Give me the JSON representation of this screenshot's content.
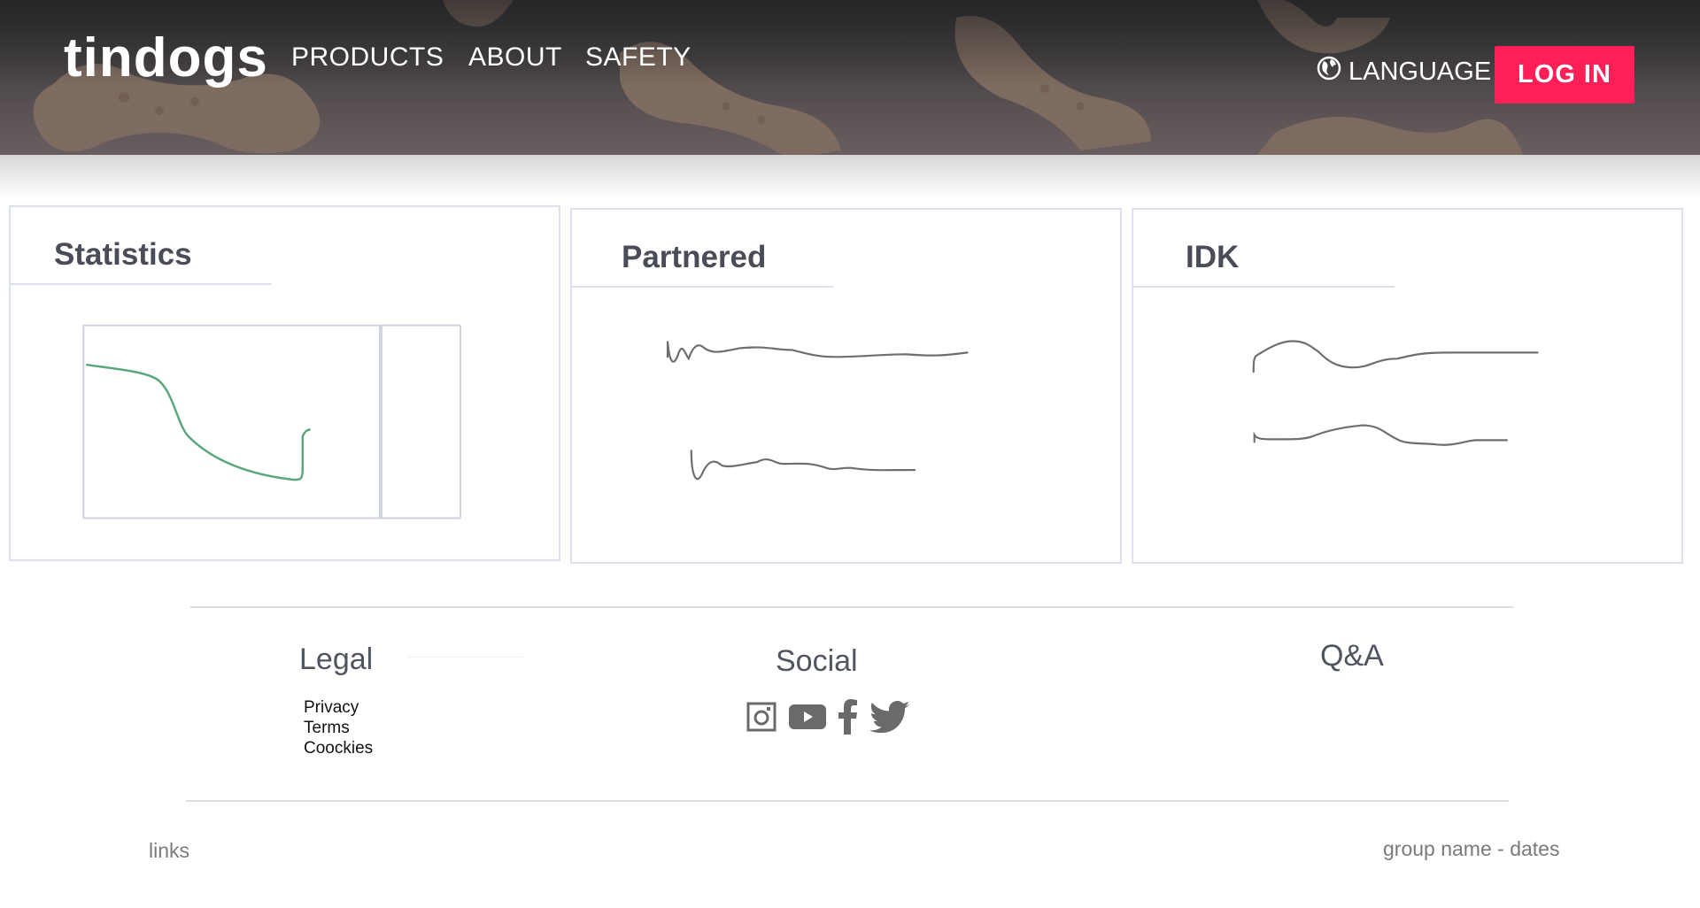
{
  "header": {
    "logo": "tindogs",
    "nav": [
      "PRODUCTS",
      "ABOUT",
      "SAFETY"
    ],
    "language_label": "LANGUAGE",
    "login_label": "LOG IN"
  },
  "cards": [
    {
      "title": "Statistics"
    },
    {
      "title": "Partnered"
    },
    {
      "title": "IDK"
    }
  ],
  "footer": {
    "legal": {
      "title": "Legal",
      "links": [
        "Privacy",
        "Terms",
        "Coockies"
      ]
    },
    "social": {
      "title": "Social",
      "icons": [
        "instagram-icon",
        "youtube-icon",
        "facebook-icon",
        "twitter-icon"
      ]
    },
    "qa": {
      "title": "Q&A"
    },
    "bottom_left": "links",
    "bottom_right": "group name - dates"
  },
  "colors": {
    "accent": "#ff1f57",
    "chart_line": "#5aa77e",
    "scribble": "#6e6e6e",
    "card_border": "#dde1ee"
  }
}
